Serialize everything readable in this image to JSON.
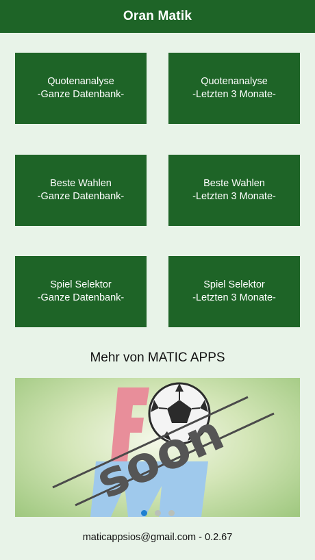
{
  "app": {
    "title": "Oran Matik"
  },
  "tiles": [
    {
      "line1": "Quotenanalyse",
      "line2": "-Ganze Datenbank-"
    },
    {
      "line1": "Quotenanalyse",
      "line2": "-Letzten 3 Monate-"
    },
    {
      "line1": "Beste Wahlen",
      "line2": "-Ganze Datenbank-"
    },
    {
      "line1": "Beste Wahlen",
      "line2": "-Letzten 3 Monate-"
    },
    {
      "line1": "Spiel Selektor",
      "line2": "-Ganze Datenbank-"
    },
    {
      "line1": "Spiel Selektor",
      "line2": "-Letzten 3 Monate-"
    }
  ],
  "more_section": {
    "heading": "Mehr von MATIC APPS"
  },
  "banner": {
    "logo_letters": [
      "F",
      "M"
    ],
    "overlay_text": "soon",
    "page_count": 3,
    "active_page": 1
  },
  "footer": {
    "text": "maticappsios@gmail.com - 0.2.67"
  },
  "colors": {
    "primary": "#1e6427",
    "background": "#e8f3e8",
    "active_dot": "#1e7fd0"
  }
}
